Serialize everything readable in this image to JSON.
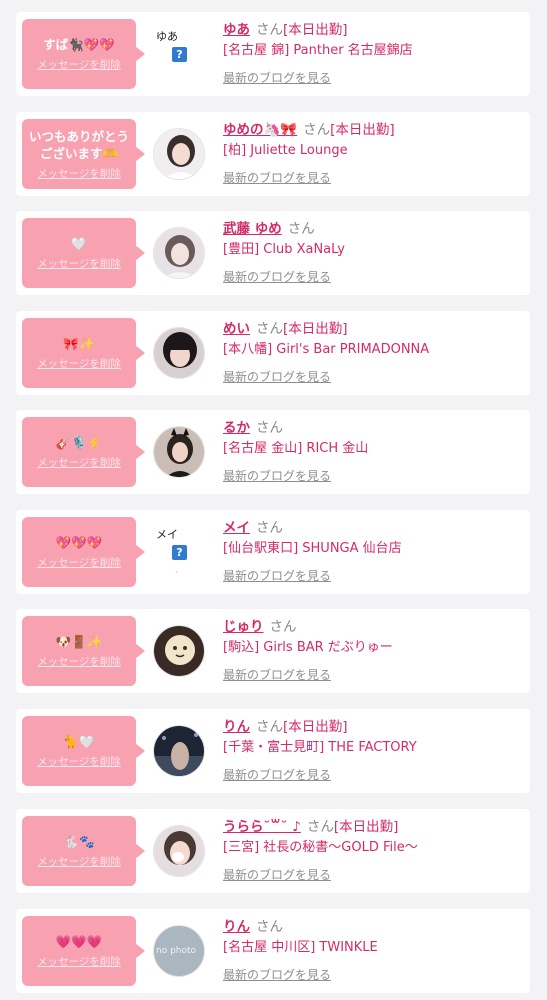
{
  "colors": {
    "accent": "#d62a66",
    "bubble": "#f7a1b1",
    "card": "#ffffff",
    "background": "#f3f3f5"
  },
  "common": {
    "delete_label": "メッセージを削除",
    "blog_label": "最新のブログを見る",
    "san": "さん",
    "on_duty": "[本日出勤]"
  },
  "cards": [
    {
      "message": "すば🐈‍⬛💖💖",
      "name": "ゆあ",
      "on_duty": true,
      "shop": "[名古屋 錦] Panther 名古屋錦店",
      "avatar_alt": "ゆあ",
      "avatar_kind": "missing"
    },
    {
      "message": "いつもありがとうございます🫶",
      "name": "ゆめの🦄🎀",
      "on_duty": true,
      "shop": "[柏] Juliette Lounge",
      "avatar_kind": "photo"
    },
    {
      "message": "🤍",
      "name": "武藤 ゆめ",
      "on_duty": false,
      "shop": "[豊田] Club XaNaLy",
      "avatar_kind": "photo"
    },
    {
      "message": "🎀✨",
      "name": "めい",
      "on_duty": true,
      "shop": "[本八幡] Girl's Bar PRIMADONNA",
      "avatar_kind": "photo"
    },
    {
      "message": "🎸🎙️⚡️",
      "name": "るか",
      "on_duty": false,
      "shop": "[名古屋 金山] RICH 金山",
      "avatar_kind": "photo"
    },
    {
      "message": "💖💖💖",
      "name": "メイ",
      "on_duty": false,
      "shop": "[仙台駅東口] SHUNGA 仙台店",
      "avatar_alt": "メイ",
      "avatar_kind": "missing"
    },
    {
      "message": "🐶🚪✨",
      "name": "じゅり",
      "on_duty": false,
      "shop": "[駒込] Girls BAR だぶりゅー",
      "avatar_kind": "photo"
    },
    {
      "message": "🐈🤍",
      "name": "りん",
      "on_duty": true,
      "shop": "[千葉・富士見町] THE FACTORY",
      "avatar_kind": "photo"
    },
    {
      "message": "🐇🐾",
      "name": "うらら˘꒳˘ ♪",
      "on_duty": true,
      "shop": "[三宮] 社長の秘書〜GOLD File〜",
      "avatar_kind": "photo"
    },
    {
      "message": "💗💗💗",
      "name": "りん",
      "on_duty": false,
      "shop": "[名古屋 中川区] TWINKLE",
      "avatar_alt": "no photo",
      "avatar_kind": "photo"
    }
  ]
}
